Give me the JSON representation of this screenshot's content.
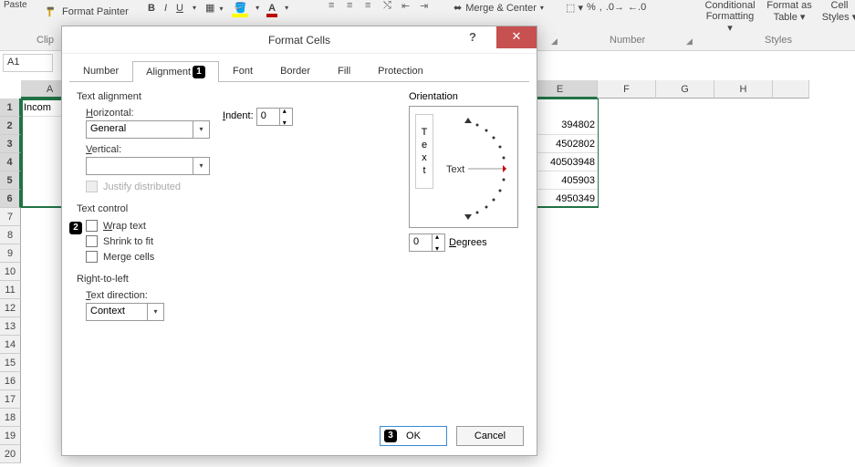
{
  "ribbon": {
    "paste": "Paste",
    "format_painter": "Format Painter",
    "clipboard_group": "Clip",
    "bold": "B",
    "italic": "I",
    "underline": "U",
    "merge": "Merge & Center",
    "number_group": "Number",
    "styles_group": "Styles",
    "percent": "%",
    "comma": ",",
    "cond_fmt": "Conditional Formatting",
    "fmt_table": "Format as Table",
    "cell_styles": "Cell Styles"
  },
  "namebox": "A1",
  "columns": [
    "E",
    "F",
    "G",
    "H"
  ],
  "rows": [
    1,
    2,
    3,
    4,
    5,
    6,
    7,
    8,
    9,
    10,
    11,
    12,
    13,
    14,
    15,
    16,
    17,
    18,
    19,
    20
  ],
  "selected_rows": [
    1,
    2,
    3,
    4,
    5,
    6
  ],
  "cellA1": "Incom",
  "colE": [
    "394802",
    "4502802",
    "40503948",
    "405903",
    "4950349"
  ],
  "dialog": {
    "title": "Format Cells",
    "help": "?",
    "close": "✕",
    "tabs": [
      "Number",
      "Alignment",
      "Font",
      "Border",
      "Fill",
      "Protection"
    ],
    "active_tab": 1,
    "sections": {
      "text_alignment": "Text alignment",
      "horizontal": "Horizontal:",
      "horizontal_u": "H",
      "horizontal_val": "General",
      "vertical": "Vertical:",
      "vertical_u": "V",
      "vertical_val": "",
      "indent": "Indent:",
      "indent_u": "I",
      "indent_val": "0",
      "justify": "Justify distributed",
      "text_control": "Text control",
      "wrap": "Wrap text",
      "wrap_u": "W",
      "shrink": "Shrink to fit",
      "merge": "Merge cells",
      "rtl": "Right-to-left",
      "textdir": "Text direction:",
      "textdir_u": "T",
      "textdir_val": "Context",
      "orientation": "Orientation",
      "orient_text": "Text",
      "degrees": "Degrees",
      "degrees_u": "D",
      "degrees_val": "0"
    },
    "ok": "OK",
    "cancel": "Cancel"
  },
  "callouts": {
    "1": "1",
    "2": "2",
    "3": "3"
  }
}
